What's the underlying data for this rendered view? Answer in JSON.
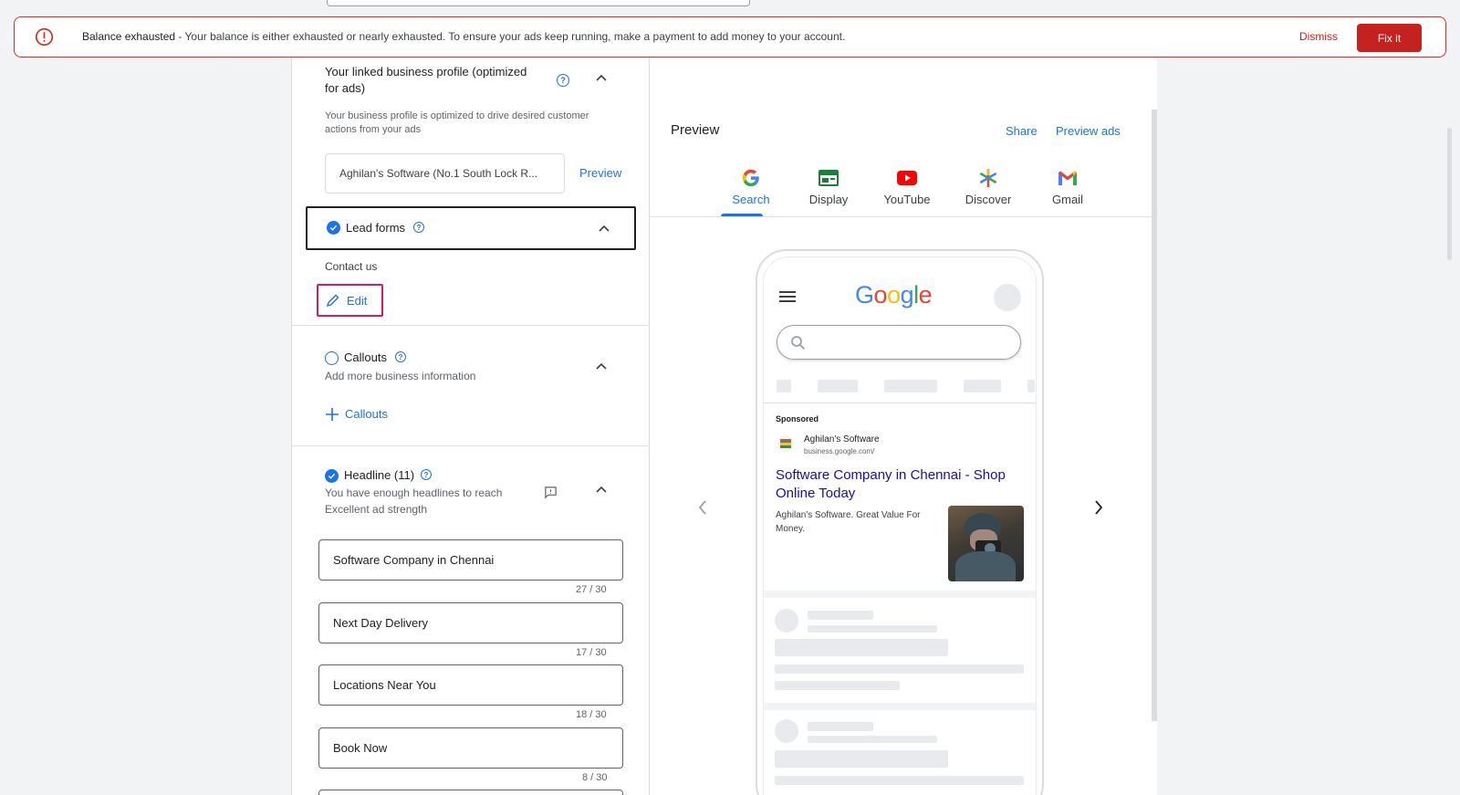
{
  "banner": {
    "title": "Balance exhausted",
    "message": " - Your balance is either exhausted or nearly exhausted. To ensure your ads keep running, make a payment to add money to your account.",
    "dismiss_label": "Dismiss",
    "fix_label": "Fix it",
    "accent_color": "#c5221f"
  },
  "business_profile": {
    "title_line1": "Your linked business profile (optimized",
    "title_line2": "for ads)",
    "desc_line1": "Your business profile is optimized to drive desired customer",
    "desc_line2": "actions from your ads",
    "profile_value": "Aghilan's Software (No.1 South Lock R...",
    "preview_label": "Preview"
  },
  "lead_forms": {
    "title": "Lead forms",
    "value": "Contact us",
    "edit_label": "Edit"
  },
  "callouts": {
    "title": "Callouts",
    "desc": "Add more business information",
    "add_label": "Callouts"
  },
  "headlines": {
    "title": "Headline (11)",
    "desc_line1": "You have enough headlines to reach",
    "desc_line2": "Excellent ad strength",
    "items": [
      {
        "text": "Software Company in Chennai",
        "count": "27 / 30"
      },
      {
        "text": "Next Day Delivery",
        "count": "17 / 30"
      },
      {
        "text": "Locations Near You",
        "count": "18 / 30"
      },
      {
        "text": "Book Now",
        "count": "8 / 30"
      }
    ]
  },
  "preview": {
    "title": "Preview",
    "share_label": "Share",
    "preview_ads_label": "Preview ads",
    "tabs": [
      "Search",
      "Display",
      "YouTube",
      "Discover",
      "Gmail"
    ],
    "active_tab": "Search"
  },
  "ad": {
    "google_logo": "Google",
    "sponsored": "Sponsored",
    "advertiser": "Aghilan's Software",
    "url": "business.google.com/",
    "headline_line1": "Software Company in Chennai - Shop",
    "headline_line2": "Online Today",
    "desc_line1": "Aghilan's Software. Great Value For",
    "desc_line2": "Money."
  }
}
